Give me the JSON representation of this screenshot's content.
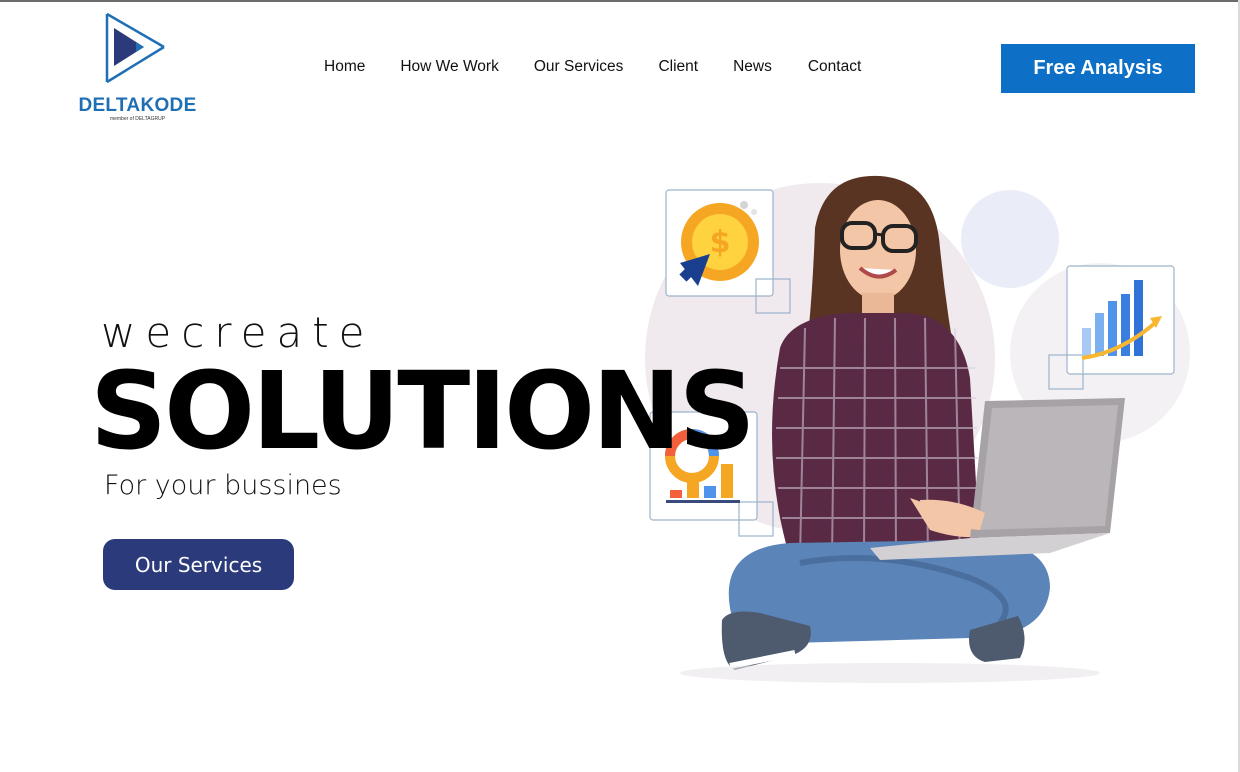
{
  "brand": {
    "name": "DELTAKODE",
    "tagline": "member of DELTAGRUP",
    "logo_icon": "play-triangle-logo",
    "colors": {
      "primary": "#1f6fb5",
      "accent": "#0d6fc6",
      "dark_blue": "#2b3a7a"
    }
  },
  "nav": {
    "items": [
      {
        "label": "Home"
      },
      {
        "label": "How We Work"
      },
      {
        "label": "Our Services"
      },
      {
        "label": "Client"
      },
      {
        "label": "News"
      },
      {
        "label": "Contact"
      }
    ]
  },
  "header": {
    "cta_label": "Free Analysis"
  },
  "hero": {
    "kicker": "wecreate",
    "headline": "SOLUTIONS",
    "subheadline": "For your bussines",
    "button_label": "Our Services"
  },
  "illustration": {
    "description_icons": [
      "dollar-coin-icon",
      "bar-chart-growth-icon",
      "donut-chart-icon"
    ]
  }
}
